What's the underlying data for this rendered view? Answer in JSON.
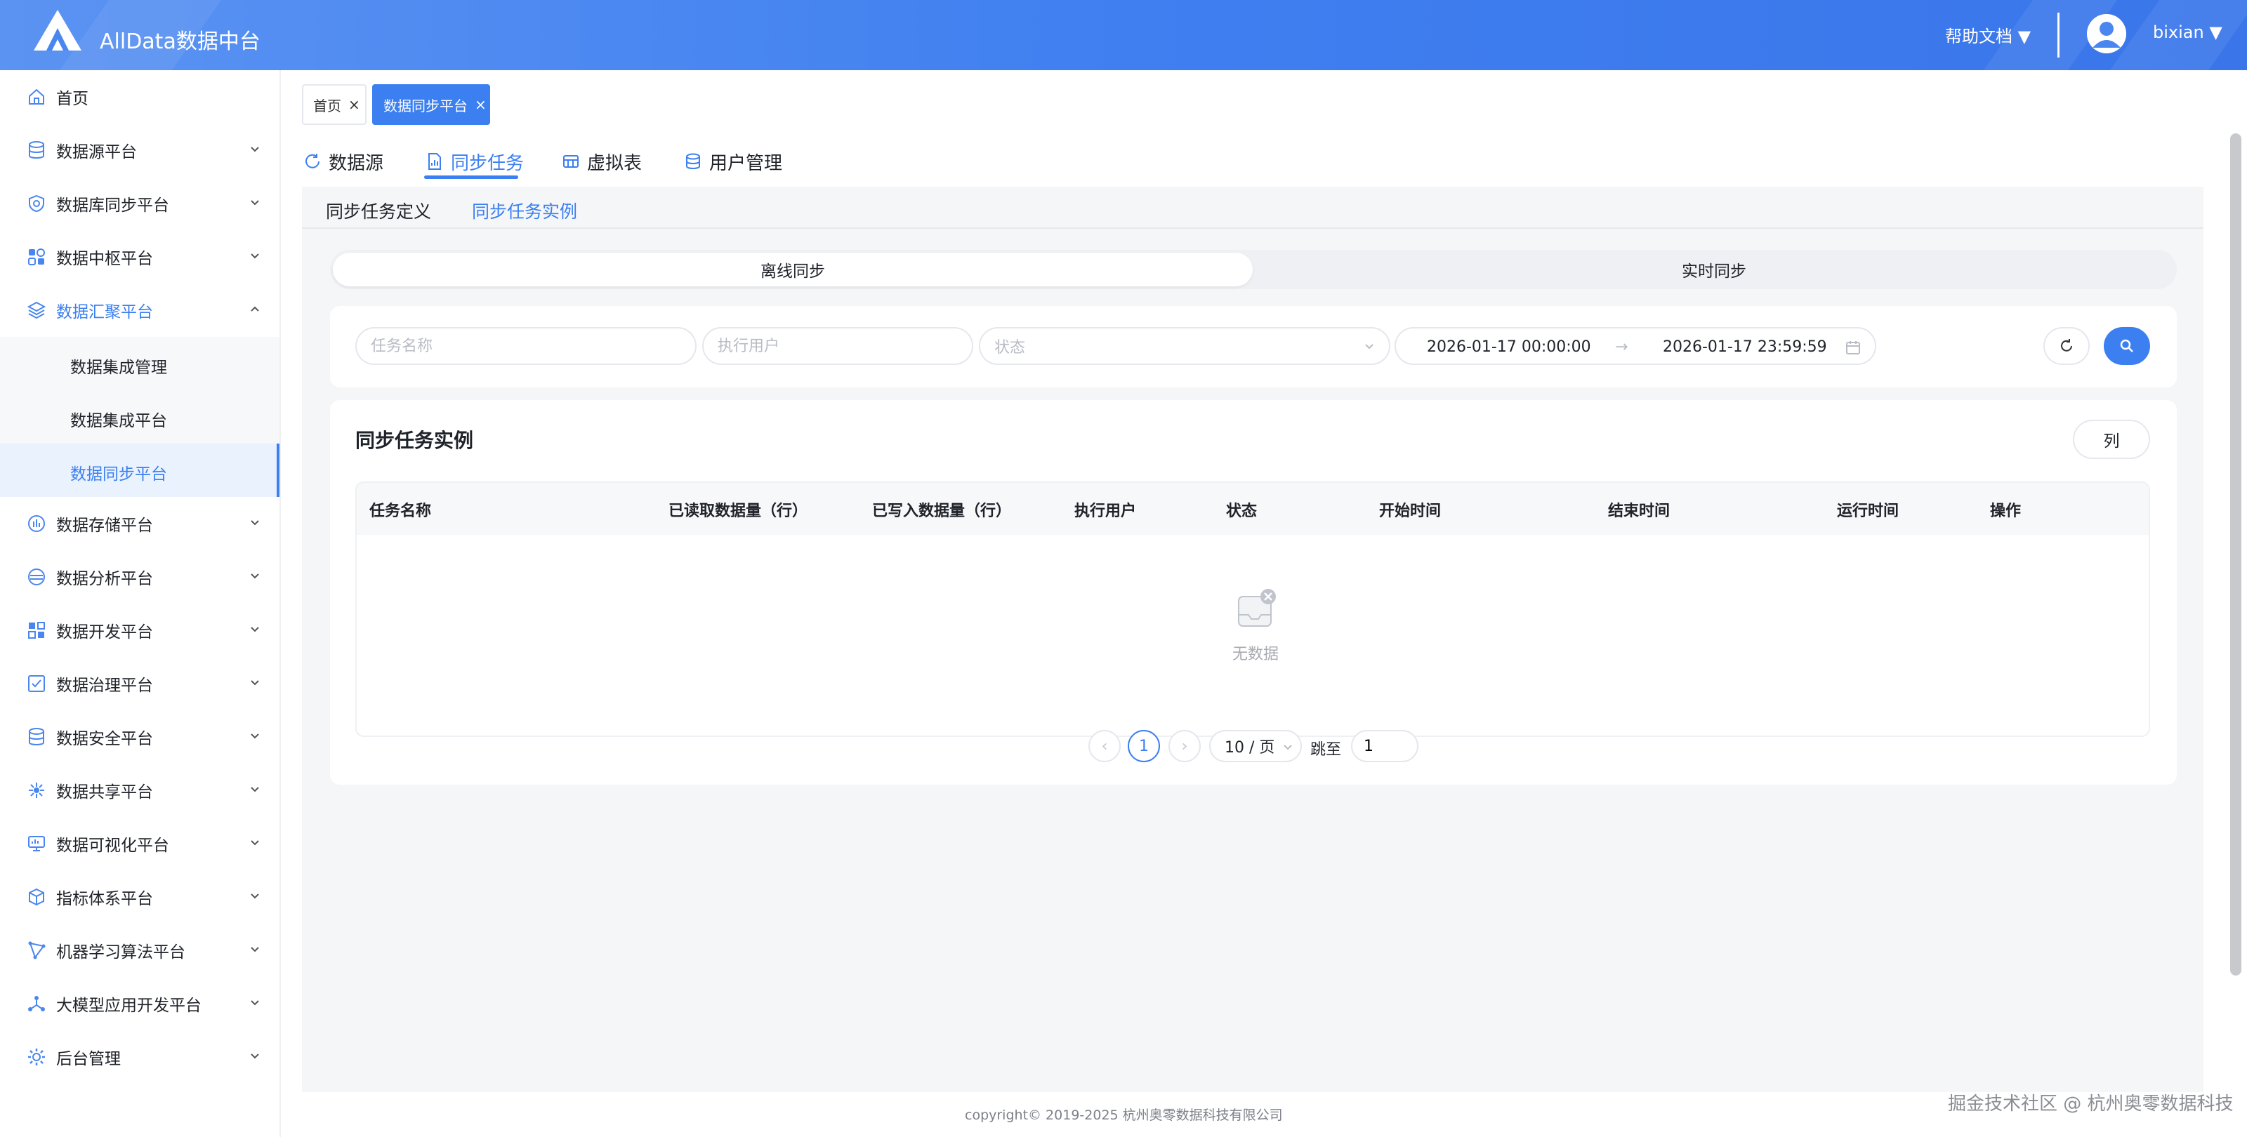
{
  "header": {
    "app_title": "AllData数据中台",
    "help_label": "帮助文档 ▼",
    "user_name": "bixian ▼",
    "logo_icon": "alldata-logo-icon",
    "colors": {
      "header_start": "#5b93f2",
      "header_end": "#3a76ea",
      "accent": "#3b7ff0"
    }
  },
  "sidebar": {
    "items": [
      {
        "label": "首页",
        "icon": "home-icon",
        "expandable": false
      },
      {
        "label": "数据源平台",
        "icon": "database-icon",
        "expandable": true
      },
      {
        "label": "数据库同步平台",
        "icon": "shield-icon",
        "expandable": true
      },
      {
        "label": "数据中枢平台",
        "icon": "apps-icon",
        "expandable": true
      },
      {
        "label": "数据汇聚平台",
        "icon": "layers-icon",
        "expandable": true,
        "open": true
      },
      {
        "label": "数据存储平台",
        "icon": "storage-chart-icon",
        "expandable": true
      },
      {
        "label": "数据分析平台",
        "icon": "analysis-icon",
        "expandable": true
      },
      {
        "label": "数据开发平台",
        "icon": "grid-icon",
        "expandable": true
      },
      {
        "label": "数据治理平台",
        "icon": "checklist-icon",
        "expandable": true
      },
      {
        "label": "数据安全平台",
        "icon": "database-secure-icon",
        "expandable": true
      },
      {
        "label": "数据共享平台",
        "icon": "share-icon",
        "expandable": true
      },
      {
        "label": "数据可视化平台",
        "icon": "monitor-icon",
        "expandable": true
      },
      {
        "label": "指标体系平台",
        "icon": "cube-icon",
        "expandable": true
      },
      {
        "label": "机器学习算法平台",
        "icon": "ml-icon",
        "expandable": true
      },
      {
        "label": "大模型应用开发平台",
        "icon": "llm-nodes-icon",
        "expandable": true
      },
      {
        "label": "后台管理",
        "icon": "settings-icon",
        "expandable": true
      }
    ],
    "sub_items": [
      {
        "label": "数据集成管理"
      },
      {
        "label": "数据集成平台"
      },
      {
        "label": "数据同步平台",
        "active": true
      }
    ]
  },
  "tags": [
    {
      "label": "首页",
      "close": "×"
    },
    {
      "label": "数据同步平台",
      "close": "×",
      "active": true
    }
  ],
  "tabs": [
    {
      "label": "数据源",
      "icon": "refresh-icon"
    },
    {
      "label": "同步任务",
      "icon": "report-icon",
      "active": true
    },
    {
      "label": "虚拟表",
      "icon": "table-icon"
    },
    {
      "label": "用户管理",
      "icon": "users-db-icon"
    }
  ],
  "subtabs": [
    {
      "label": "同步任务定义"
    },
    {
      "label": "同步任务实例",
      "active": true
    }
  ],
  "segment": {
    "options": [
      {
        "label": "离线同步",
        "active": true
      },
      {
        "label": "实时同步"
      }
    ]
  },
  "filters": {
    "task_name_placeholder": "任务名称",
    "exec_user_placeholder": "执行用户",
    "status_placeholder": "状态",
    "date_start": "2026-01-17 00:00:00",
    "date_arrow": "→",
    "date_end": "2026-01-17 23:59:59"
  },
  "table": {
    "title": "同步任务实例",
    "columns_button": "列",
    "headers": [
      "任务名称",
      "已读取数据量（行）",
      "已写入数据量（行）",
      "执行用户",
      "状态",
      "开始时间",
      "结束时间",
      "运行时间",
      "操作"
    ],
    "rows": [],
    "empty_text": "无数据"
  },
  "pagination": {
    "prev": "‹",
    "current_page": "1",
    "next": "›",
    "page_size": "10 / 页",
    "jump_label": "跳至",
    "jump_value": "1"
  },
  "footer": {
    "copyright": "copyright© 2019-2025 杭州奥零数据科技有限公司",
    "watermark": "掘金技术社区 @ 杭州奥零数据科技"
  }
}
